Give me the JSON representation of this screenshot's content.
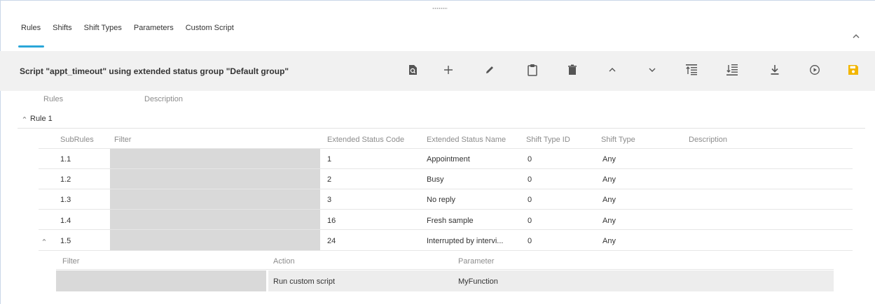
{
  "tabs": [
    "Rules",
    "Shifts",
    "Shift Types",
    "Parameters",
    "Custom Script"
  ],
  "active_tab": "Rules",
  "toolbar": {
    "title": "Script \"appt_timeout\" using extended status group \"Default group\"",
    "icons": [
      "preview-icon",
      "add-icon",
      "edit-icon",
      "clipboard-icon",
      "delete-icon",
      "move-up-icon",
      "move-down-icon",
      "move-to-top-icon",
      "move-to-bottom-icon",
      "download-icon",
      "run-icon",
      "save-icon"
    ],
    "save_color": "#f2b600"
  },
  "rules_table": {
    "headers": {
      "rules": "Rules",
      "description": "Description"
    },
    "rule_label": "Rule 1"
  },
  "subrules_table": {
    "headers": [
      "SubRules",
      "Filter",
      "Extended Status Code",
      "Extended Status Name",
      "Shift Type ID",
      "Shift Type",
      "Description"
    ],
    "rows": [
      {
        "id": "1.1",
        "code": "1",
        "name": "Appointment",
        "shift_type_id": "0",
        "shift_type": "Any"
      },
      {
        "id": "1.2",
        "code": "2",
        "name": "Busy",
        "shift_type_id": "0",
        "shift_type": "Any"
      },
      {
        "id": "1.3",
        "code": "3",
        "name": "No reply",
        "shift_type_id": "0",
        "shift_type": "Any"
      },
      {
        "id": "1.4",
        "code": "16",
        "name": "Fresh sample",
        "shift_type_id": "0",
        "shift_type": "Any"
      },
      {
        "id": "1.5",
        "code": "24",
        "name": "Interrupted by intervi...",
        "shift_type_id": "0",
        "shift_type": "Any"
      }
    ]
  },
  "actions_table": {
    "headers": {
      "filter": "Filter",
      "action": "Action",
      "parameter": "Parameter"
    },
    "row": {
      "action": "Run custom script",
      "parameter": "MyFunction"
    }
  },
  "colors": {
    "accent": "#2aa6d8",
    "toolbar_bg": "#f1f1f1",
    "filter_bg": "#d9d9d9"
  }
}
